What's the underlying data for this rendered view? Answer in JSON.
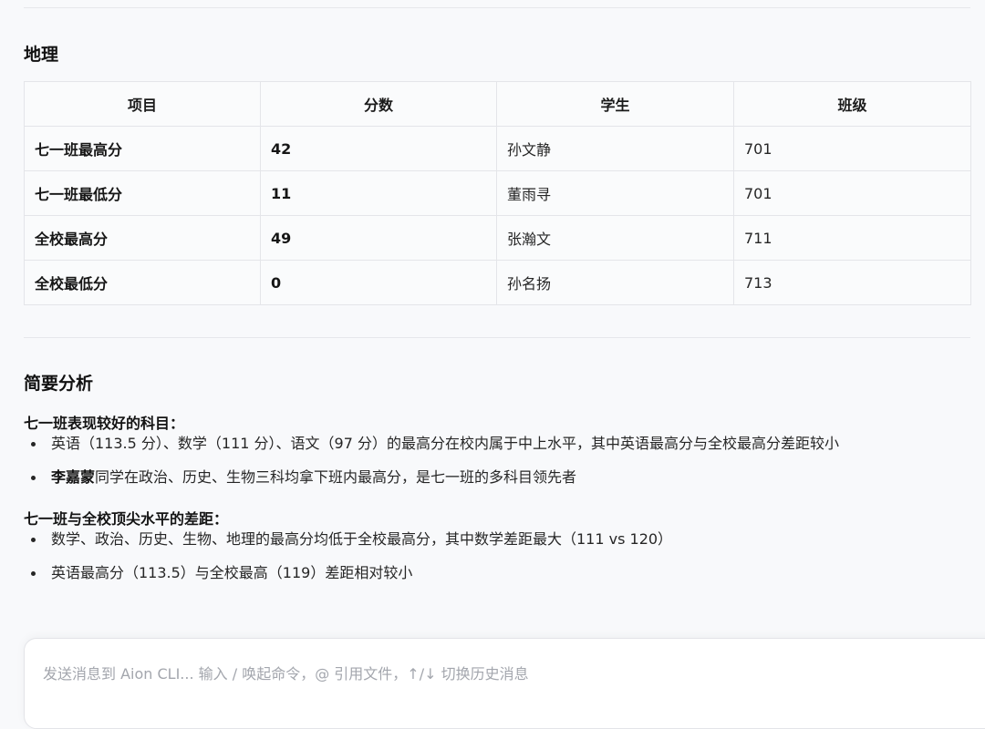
{
  "geography": {
    "title": "地理",
    "headers": [
      "项目",
      "分数",
      "学生",
      "班级"
    ],
    "rows": [
      {
        "item": "七一班最高分",
        "score": "42",
        "student": "孙文静",
        "class": "701"
      },
      {
        "item": "七一班最低分",
        "score": "11",
        "student": "董雨寻",
        "class": "701"
      },
      {
        "item": "全校最高分",
        "score": "49",
        "student": "张瀚文",
        "class": "711"
      },
      {
        "item": "全校最低分",
        "score": "0",
        "student": "孙名扬",
        "class": "713"
      }
    ]
  },
  "analysis": {
    "title": "简要分析",
    "strengths": {
      "heading": "七一班表现较好的科目：",
      "bullets": [
        {
          "text": "英语（113.5 分）、数学（111 分）、语文（97 分）的最高分在校内属于中上水平，其中英语最高分与全校最高分差距较小"
        },
        {
          "strong": "李嘉蒙",
          "text": "同学在政治、历史、生物三科均拿下班内最高分，是七一班的多科目领先者"
        }
      ]
    },
    "gaps": {
      "heading": "七一班与全校顶尖水平的差距：",
      "bullets": [
        {
          "text": "数学、政治、历史、生物、地理的最高分均低于全校最高分，其中数学差距最大（111 vs 120）"
        },
        {
          "text": "英语最高分（113.5）与全校最高（119）差距相对较小"
        }
      ]
    }
  },
  "composer": {
    "placeholder": "发送消息到 Aion CLI... 输入 / 唤起命令，@ 引用文件，↑/↓ 切换历史消息"
  }
}
